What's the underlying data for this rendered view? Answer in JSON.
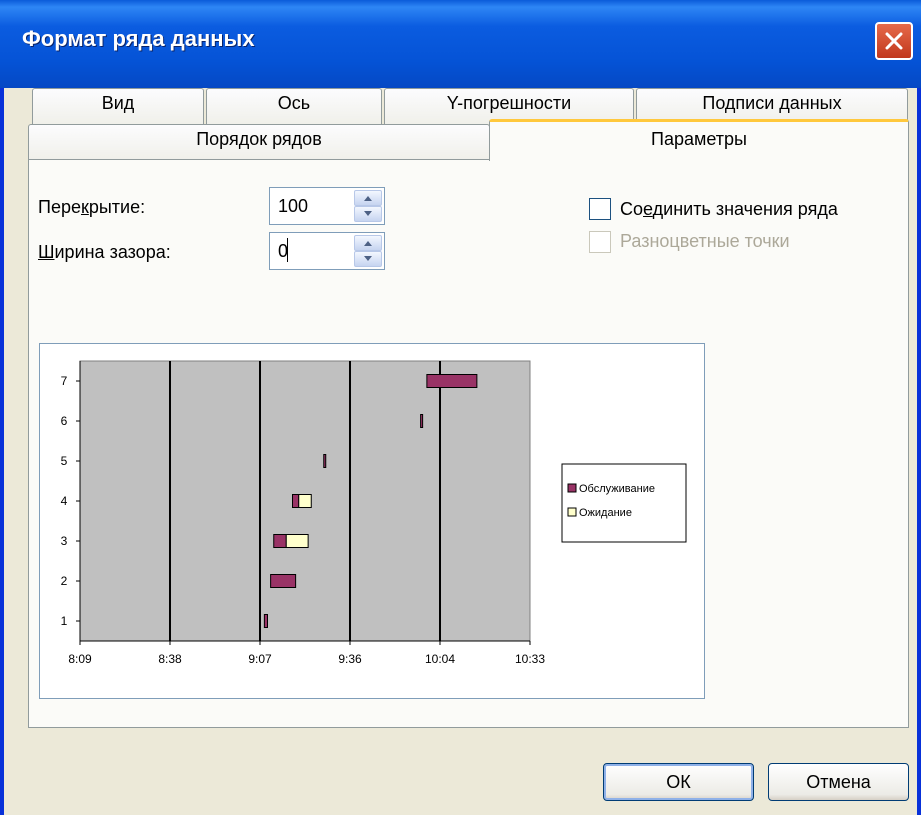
{
  "window": {
    "title": "Формат ряда данных"
  },
  "tabs_row1": [
    {
      "label": "Вид"
    },
    {
      "label": "Ось"
    },
    {
      "label": "Y-погрешности"
    },
    {
      "label": "Подписи данных"
    }
  ],
  "tabs_row2": [
    {
      "label": "Порядок рядов"
    },
    {
      "label": "Параметры",
      "active": true
    }
  ],
  "options": {
    "overlap_label_pre": "Пере",
    "overlap_label_key": "к",
    "overlap_label_post": "рытие:",
    "overlap_value": "100",
    "gap_label_key": "Ш",
    "gap_label_post": "ирина зазора:",
    "gap_value": "0",
    "connect_label_pre": "Со",
    "connect_label_key": "е",
    "connect_label_post": "динить значения ряда",
    "connect_checked": false,
    "vary_colors_label": "Разноцветные точки",
    "vary_colors_enabled": false
  },
  "chart_data": {
    "type": "bar",
    "orientation": "horizontal-stacked",
    "x_ticks": [
      "8:09",
      "8:38",
      "9:07",
      "9:36",
      "10:04",
      "10:33"
    ],
    "y_categories": [
      "1",
      "2",
      "3",
      "4",
      "5",
      "6",
      "7"
    ],
    "grid": true,
    "legend_position": "right",
    "series": [
      {
        "name": "Обслуживание",
        "color": "#993366",
        "values": [
          [
            "9:08",
            "9:09"
          ],
          [
            "9:10",
            "9:18"
          ],
          [
            "9:11",
            "9:15"
          ],
          [
            "9:17",
            "9:19"
          ],
          [
            "9:27",
            "9:27"
          ],
          [
            "9:58",
            "9:58"
          ],
          [
            "10:00",
            "10:16"
          ]
        ]
      },
      {
        "name": "Ожидание",
        "color": "#ffffcc",
        "values": [
          null,
          null,
          [
            "9:15",
            "9:22"
          ],
          [
            "9:19",
            "9:23"
          ],
          null,
          null,
          null
        ]
      }
    ]
  },
  "buttons": {
    "ok": "ОК",
    "cancel": "Отмена"
  }
}
